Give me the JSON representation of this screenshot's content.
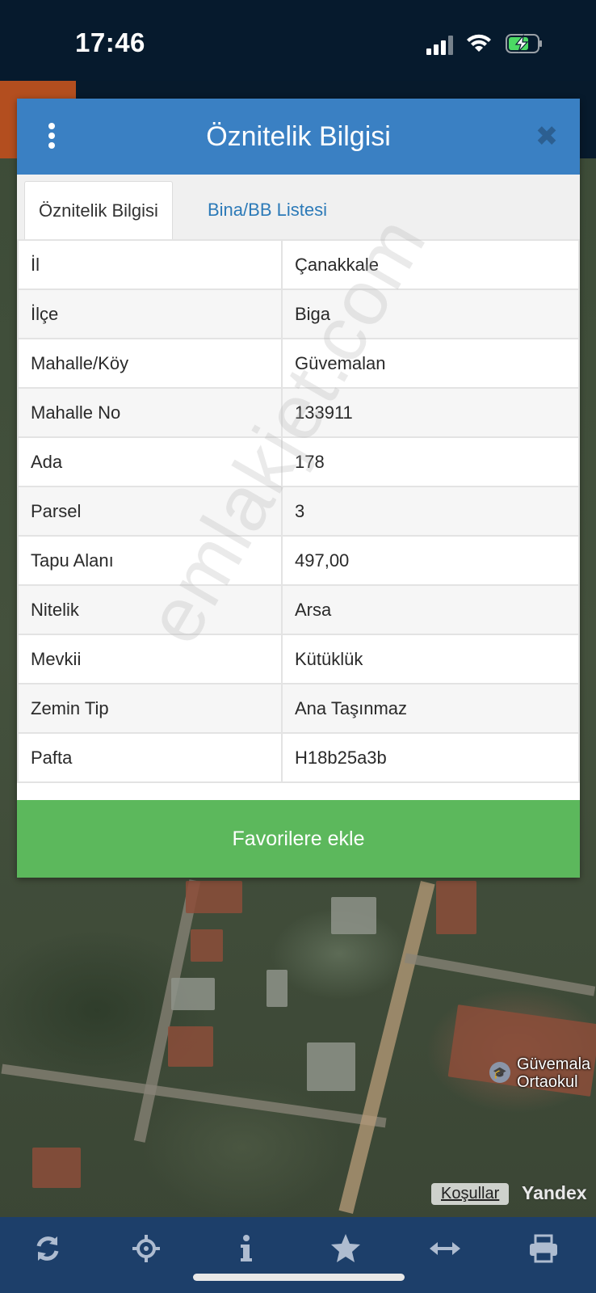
{
  "status_bar": {
    "time": "17:46"
  },
  "dialog": {
    "title": "Öznitelik Bilgisi",
    "tabs": [
      {
        "label": "Öznitelik Bilgisi",
        "active": true
      },
      {
        "label": "Bina/BB Listesi",
        "active": false
      }
    ],
    "rows": [
      {
        "key": "İl",
        "value": "Çanakkale"
      },
      {
        "key": "İlçe",
        "value": "Biga"
      },
      {
        "key": "Mahalle/Köy",
        "value": "Güvemalan"
      },
      {
        "key": "Mahalle No",
        "value": "133911"
      },
      {
        "key": "Ada",
        "value": "178"
      },
      {
        "key": "Parsel",
        "value": "3"
      },
      {
        "key": "Tapu Alanı",
        "value": "497,00"
      },
      {
        "key": "Nitelik",
        "value": "Arsa"
      },
      {
        "key": "Mevkii",
        "value": "Kütüklük"
      },
      {
        "key": "Zemin Tip",
        "value": "Ana Taşınmaz"
      },
      {
        "key": "Pafta",
        "value": "H18b25a3b"
      }
    ],
    "favorite_button": "Favorilere ekle"
  },
  "watermark": "emlakjet.com",
  "map": {
    "place_label_line1": "Güvemala",
    "place_label_line2": "Ortaokul",
    "terms_link": "Koşullar",
    "provider": "Yandex"
  },
  "toolbar": {
    "icons": [
      "refresh-icon",
      "locate-crosshair-icon",
      "info-icon",
      "star-icon",
      "measure-arrows-icon",
      "print-icon"
    ]
  },
  "colors": {
    "header_blue": "#3a80c3",
    "favorite_green": "#5cb85c",
    "toolbar_navy": "#1d3f6a",
    "status_bar": "#061a2d"
  }
}
